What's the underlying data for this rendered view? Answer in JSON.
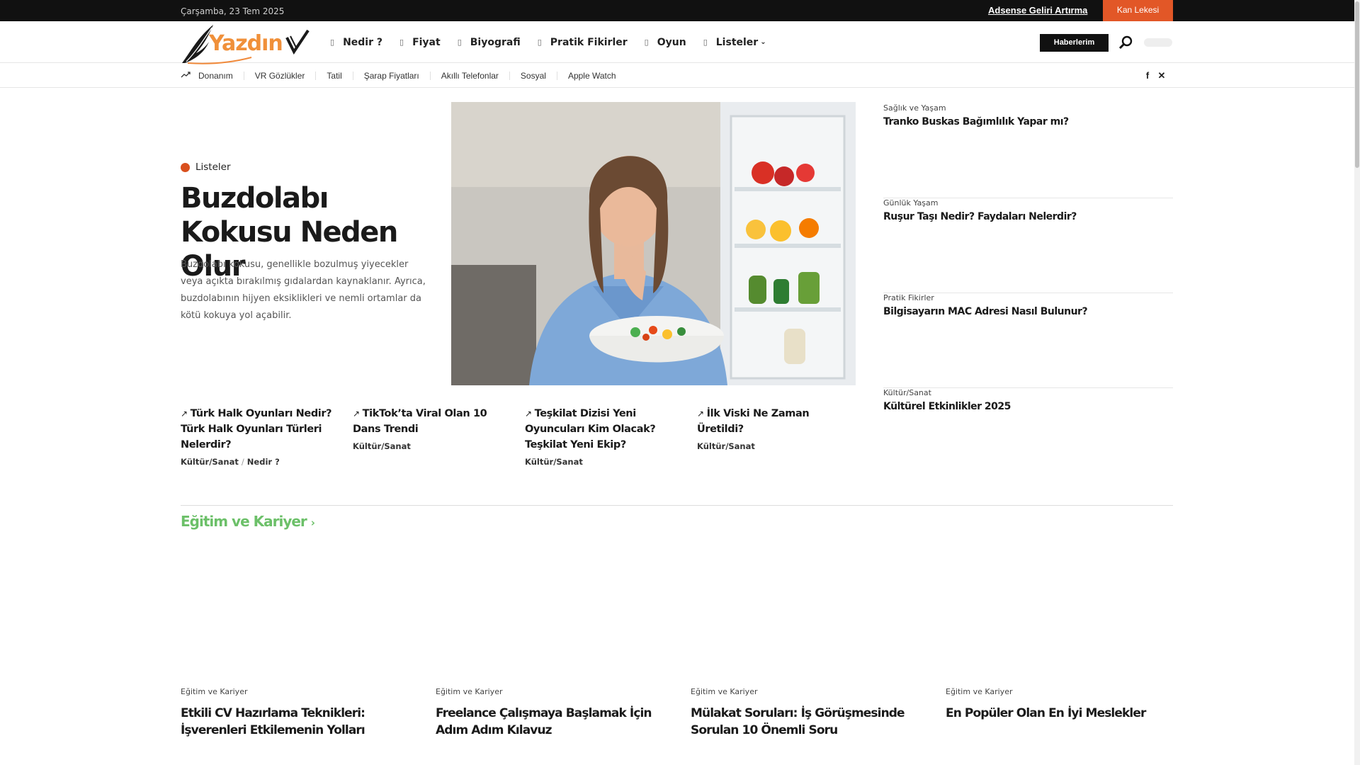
{
  "topbar": {
    "date": "Çarşamba, 23 Tem 2025",
    "link": "Adsense Geliri Artırma",
    "button": "Kan Lekesi"
  },
  "header": {
    "logo_text": "Yazdın",
    "nav": [
      {
        "label": "Nedir ?"
      },
      {
        "label": "Fiyat"
      },
      {
        "label": "Biyografi"
      },
      {
        "label": "Pratik Fikirler"
      },
      {
        "label": "Oyun"
      },
      {
        "label": "Listeler"
      }
    ],
    "news_button": "Haberlerim"
  },
  "trending": {
    "items": [
      "Donanım",
      "VR Gözlükler",
      "Tatil",
      "Şarap Fiyatları",
      "Akıllı Telefonlar",
      "Sosyal",
      "Apple Watch"
    ]
  },
  "hero": {
    "category": "Listeler",
    "title": "Buzdolabı Kokusu Neden Olur",
    "description": "Buzdolabı kokusu, genellikle bozulmuş yiyecekler veya açıkta bırakılmış gıdalardan kaynaklanır. Ayrıca, buzdolabının hijyen eksiklikleri ve nemli ortamlar da kötü kokuya yol açabilir."
  },
  "mini_posts": [
    {
      "title": "Türk Halk Oyunları Nedir? Türk Halk Oyunları Türleri Nelerdir?",
      "category": "Kültür/Sanat",
      "category2": "Nedir ?",
      "sep": "/"
    },
    {
      "title": "TikTok’ta Viral Olan 10 Dans Trendi",
      "category": "Kültür/Sanat"
    },
    {
      "title": "Teşkilat Dizisi Yeni Oyuncuları Kim Olacak? Teşkilat Yeni Ekip?",
      "category": "Kültür/Sanat"
    },
    {
      "title": "İlk Viski Ne Zaman Üretildi?",
      "category": "Kültür/Sanat"
    }
  ],
  "side_posts": [
    {
      "category": "Sağlık ve Yaşam",
      "title": "Tranko Buskas Bağımlılık Yapar mı?"
    },
    {
      "category": "Günlük Yaşam",
      "title": "Ruşur Taşı Nedir? Faydaları Nelerdir?"
    },
    {
      "category": "Pratik Fikirler",
      "title": "Bilgisayarın MAC Adresi Nasıl Bulunur?"
    },
    {
      "category": "Kültür/Sanat",
      "title": "Kültürel Etkinlikler 2025"
    }
  ],
  "section": {
    "title": "Eğitim ve Kariyer",
    "cards": [
      {
        "category": "Eğitim ve Kariyer",
        "title": "Etkili CV Hazırlama Teknikleri: İşverenleri Etkilemenin Yolları"
      },
      {
        "category": "Eğitim ve Kariyer",
        "title": "Freelance Çalışmaya Başlamak İçin Adım Adım Kılavuz"
      },
      {
        "category": "Eğitim ve Kariyer",
        "title": "Mülakat Soruları: İş Görüşmesinde Sorulan 10 Önemli Soru"
      },
      {
        "category": "Eğitim ve Kariyer",
        "title": "En Popüler Olan En İyi Meslekler"
      }
    ]
  },
  "colors": {
    "accent_orange": "#e25727",
    "section_green": "#6cc069",
    "topbar_bg": "#111111"
  }
}
